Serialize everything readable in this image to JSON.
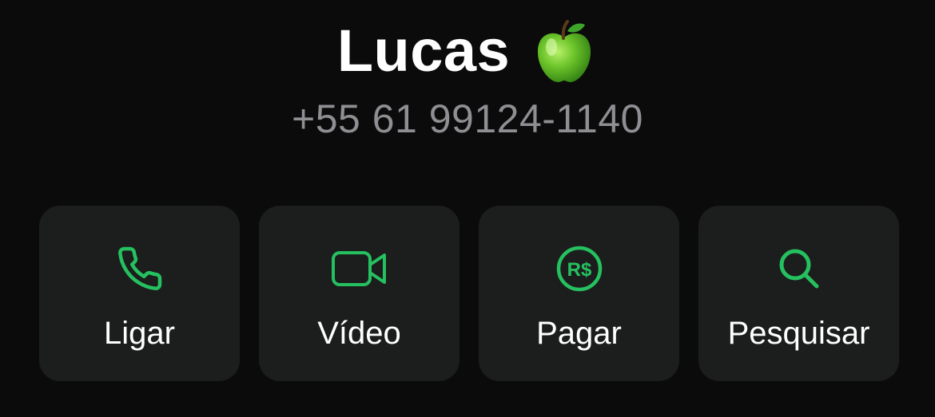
{
  "contact": {
    "name": "Lucas",
    "emoji_icon": "green-apple-icon",
    "phone": "+55 61 99124-1140"
  },
  "actions": [
    {
      "label": "Ligar",
      "icon": "phone-icon"
    },
    {
      "label": "Vídeo",
      "icon": "video-camera-icon"
    },
    {
      "label": "Pagar",
      "icon": "real-currency-icon"
    },
    {
      "label": "Pesquisar",
      "icon": "search-icon"
    }
  ],
  "colors": {
    "background": "#0b0b0b",
    "card": "#1c1d1d",
    "accent": "#25c05f",
    "name_text": "#ffffff",
    "phone_text": "#8e8e93"
  }
}
